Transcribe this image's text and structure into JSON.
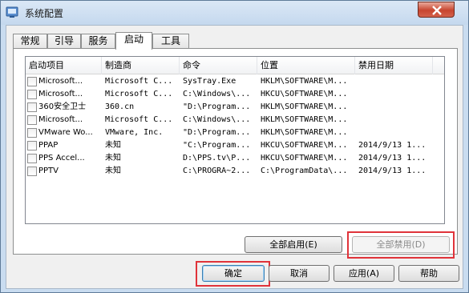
{
  "window": {
    "title": "系统配置",
    "title_icon": "msconfig-icon",
    "close_icon": "close-icon"
  },
  "tabs": [
    {
      "label": "常规",
      "active": false
    },
    {
      "label": "引导",
      "active": false
    },
    {
      "label": "服务",
      "active": false
    },
    {
      "label": "启动",
      "active": true
    },
    {
      "label": "工具",
      "active": false
    }
  ],
  "startup_list": {
    "columns": [
      "启动项目",
      "制造商",
      "命令",
      "位置",
      "禁用日期"
    ],
    "rows": [
      {
        "item": "Microsoft...",
        "maker": "Microsoft C...",
        "command": "SysTray.Exe",
        "location": "HKLM\\SOFTWARE\\M...",
        "disabled": ""
      },
      {
        "item": "Microsoft...",
        "maker": "Microsoft C...",
        "command": "C:\\Windows\\...",
        "location": "HKCU\\SOFTWARE\\M...",
        "disabled": ""
      },
      {
        "item": "360安全卫士",
        "maker": "360.cn",
        "command": "\"D:\\Program...",
        "location": "HKLM\\SOFTWARE\\M...",
        "disabled": ""
      },
      {
        "item": "Microsoft...",
        "maker": "Microsoft C...",
        "command": "C:\\Windows\\...",
        "location": "HKLM\\SOFTWARE\\M...",
        "disabled": ""
      },
      {
        "item": "VMware Wo...",
        "maker": "VMware, Inc.",
        "command": "\"D:\\Program...",
        "location": "HKLM\\SOFTWARE\\M...",
        "disabled": ""
      },
      {
        "item": "PPAP",
        "maker": "未知",
        "command": "\"C:\\Program...",
        "location": "HKCU\\SOFTWARE\\M...",
        "disabled": "2014/9/13 1..."
      },
      {
        "item": "PPS Accel...",
        "maker": "未知",
        "command": "D:\\PPS.tv\\P...",
        "location": "HKCU\\SOFTWARE\\M...",
        "disabled": "2014/9/13 1..."
      },
      {
        "item": "PPTV",
        "maker": "未知",
        "command": "C:\\PROGRA~2...",
        "location": "C:\\ProgramData\\...",
        "disabled": "2014/9/13 1..."
      }
    ]
  },
  "panel_buttons": {
    "enable_all": "全部启用(E)",
    "disable_all": "全部禁用(D)"
  },
  "dialog_buttons": {
    "ok": "确定",
    "cancel": "取消",
    "apply": "应用(A)",
    "help": "帮助"
  },
  "colors": {
    "highlight_box": "#e0333a",
    "title_bg": "#c4d8ee",
    "close_button": "#c7452f"
  }
}
